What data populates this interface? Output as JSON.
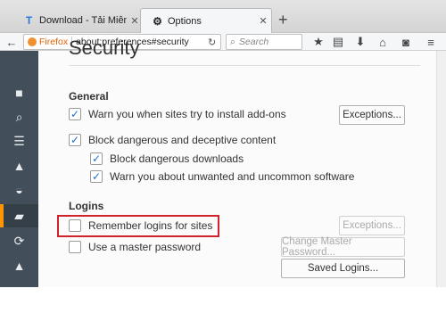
{
  "tabs": [
    {
      "label": "Download - Tải Miễn Phí VN",
      "favicon": "T",
      "favicon_color": "#2b7bd8",
      "close": "✕"
    },
    {
      "label": "Options",
      "favicon": "⚙",
      "close": "✕"
    }
  ],
  "new_tab": "+",
  "nav": {
    "back": "←",
    "identity": "Firefox",
    "url": "about:preferences#security",
    "reload": "↻",
    "search_placeholder": "Search",
    "search_icon": "🔍"
  },
  "toolbar_icons": [
    "★",
    "▤",
    "⬇",
    "⌂",
    "◙",
    "≡"
  ],
  "sidebar": {
    "items": [
      {
        "icon": "general-icon",
        "glyph": "▤"
      },
      {
        "icon": "search-icon",
        "glyph": "🔍"
      },
      {
        "icon": "content-icon",
        "glyph": "▤"
      },
      {
        "icon": "applications-icon",
        "glyph": "▲"
      },
      {
        "icon": "privacy-icon",
        "glyph": "◓"
      },
      {
        "icon": "security-icon",
        "glyph": "🔒"
      },
      {
        "icon": "sync-icon",
        "glyph": "⟳"
      },
      {
        "icon": "advanced-icon",
        "glyph": "▲"
      }
    ],
    "selected_index": 5,
    "accent": "#ff9500"
  },
  "page": {
    "title": "Security",
    "general": {
      "heading": "General",
      "warn_addons": {
        "label": "Warn you when sites try to install add-ons",
        "checked": true
      },
      "exceptions1": "Exceptions...",
      "block_dangerous": {
        "label": "Block dangerous and deceptive content",
        "checked": true
      },
      "block_downloads": {
        "label": "Block dangerous downloads",
        "checked": true
      },
      "warn_unwanted": {
        "label": "Warn you about unwanted and uncommon software",
        "checked": true
      }
    },
    "logins": {
      "heading": "Logins",
      "remember": {
        "label": "Remember logins for sites",
        "checked": false
      },
      "exceptions2": "Exceptions...",
      "master": {
        "label": "Use a master password",
        "checked": false
      },
      "change_master": "Change Master Password...",
      "saved_logins": "Saved Logins..."
    }
  },
  "check_mark": "✓",
  "highlight_color": "#d0232b"
}
